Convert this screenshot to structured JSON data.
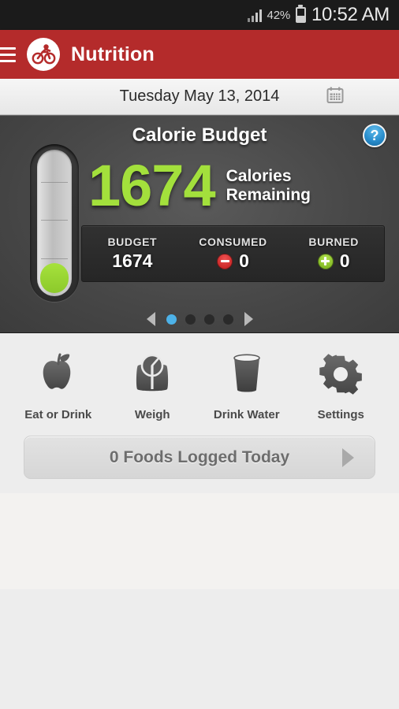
{
  "status_bar": {
    "signal_icon": "signal-bars-icon",
    "battery_percent": "42%",
    "battery_icon": "battery-icon",
    "time": "10:52 AM"
  },
  "app_bar": {
    "menu_icon": "hamburger-menu-icon",
    "logo_icon": "cyclist-logo-icon",
    "title": "Nutrition",
    "background_color": "#b42b2b"
  },
  "date_bar": {
    "date": "Tuesday May 13, 2014",
    "calendar_icon": "calendar-icon"
  },
  "calorie_card": {
    "title": "Calorie Budget",
    "help_icon": "help-question-icon",
    "gauge_icon": "vertical-gauge-icon",
    "remaining_value": "1674",
    "remaining_label_line1": "Calories",
    "remaining_label_line2": "Remaining",
    "remaining_color": "#a3e03c",
    "stats": [
      {
        "label": "BUDGET",
        "value": "1674",
        "badge": "none"
      },
      {
        "label": "CONSUMED",
        "value": "0",
        "badge": "minus-icon"
      },
      {
        "label": "BURNED",
        "value": "0",
        "badge": "plus-icon"
      }
    ],
    "pager": {
      "prev_icon": "arrow-left-icon",
      "next_icon": "arrow-right-icon",
      "total_dots": 4,
      "active_dot": 1,
      "active_color": "#4db2e8"
    }
  },
  "actions": [
    {
      "label": "Eat or Drink",
      "icon": "apple-icon"
    },
    {
      "label": "Weigh",
      "icon": "scale-icon"
    },
    {
      "label": "Drink Water",
      "icon": "glass-icon"
    },
    {
      "label": "Settings",
      "icon": "gear-icon"
    }
  ],
  "logged_button": {
    "label": "0 Foods Logged Today",
    "arrow_icon": "arrow-right-icon"
  }
}
